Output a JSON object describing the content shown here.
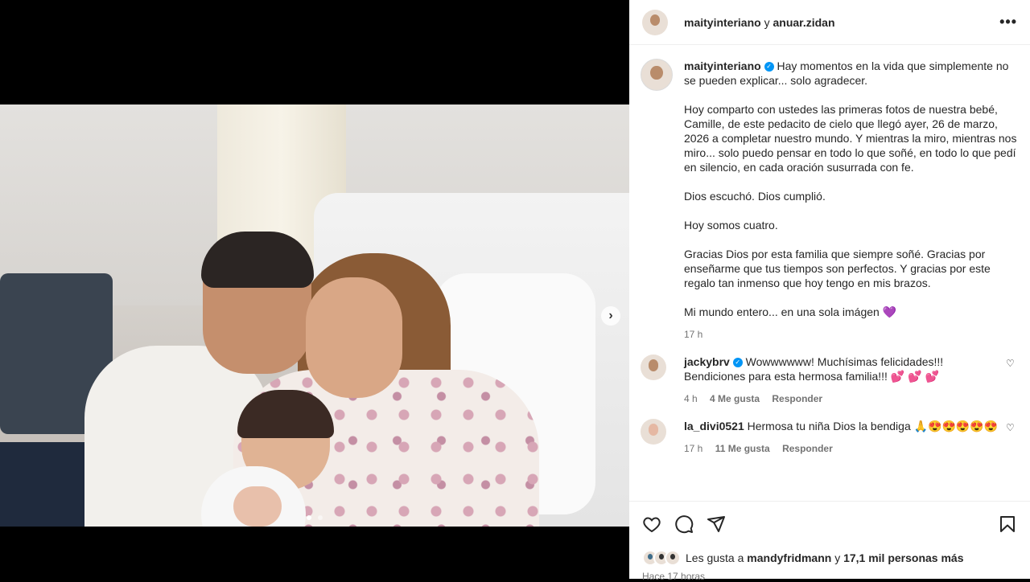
{
  "header": {
    "user1": "maityinteriano",
    "separator": "y",
    "user2": "anuar.zidan",
    "more": "•••"
  },
  "caption": {
    "username": "maityinteriano",
    "paragraphs": [
      "Hay momentos en la vida que simplemente no se pueden explicar... solo agradecer.",
      "Hoy comparto con ustedes las primeras fotos de nuestra bebé, Camille, de este pedacito de cielo que llegó ayer, 26 de marzo, 2026 a completar nuestro mundo. Y mientras la miro, mientras nos miro... solo puedo pensar en todo lo que soñé, en todo lo que pedí en silencio, en cada oración susurrada con fe.",
      "Dios escuchó. Dios cumplió.",
      "Hoy somos cuatro.",
      "Gracias Dios por esta familia que siempre soñé. Gracias por enseñarme que tus tiempos son perfectos. Y gracias por este regalo tan inmenso que hoy tengo en mis brazos.",
      "Mi mundo entero... en una sola imágen 💜"
    ],
    "time": "17 h"
  },
  "comments": [
    {
      "username": "jackybrv",
      "text": "Wowwwwww! Muchísimas felicidades!!! Bendiciones para esta hermosa familia!!! 💕 💕 💕",
      "time": "4 h",
      "likes": "4 Me gusta",
      "reply": "Responder"
    },
    {
      "username": "la_divi0521",
      "text": "Hermosa tu niña Dios la bendiga 🙏😍😍😍😍😍",
      "time": "17 h",
      "likes": "11 Me gusta",
      "reply": "Responder"
    }
  ],
  "likes": {
    "prefix": "Les gusta a",
    "user": "mandyfridmann",
    "connector": "y",
    "others": "17,1 mil personas más"
  },
  "post_time": "Hace 17 horas",
  "carousel": {
    "current_index": 1,
    "total": 2
  }
}
